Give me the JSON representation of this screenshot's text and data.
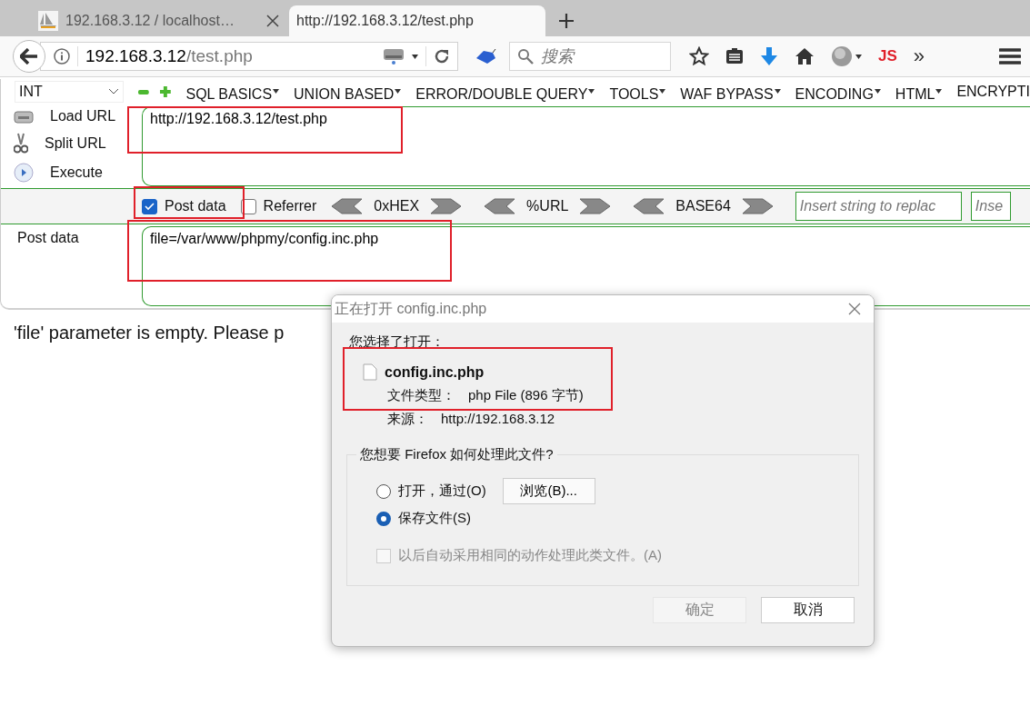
{
  "tabs": [
    {
      "title": "192.168.3.12 / localhost…",
      "selected": false
    },
    {
      "title": "http://192.168.3.12/test.php",
      "selected": true
    }
  ],
  "address_bar": {
    "host": "192.168.3.12",
    "path": "/test.php"
  },
  "search": {
    "placeholder": "搜索"
  },
  "toolbar": {
    "js_button": "JS",
    "overflow": "»"
  },
  "hackbar": {
    "select": "INT",
    "menus": [
      {
        "label": "SQL BASICS",
        "dropdown": true
      },
      {
        "label": "UNION BASED",
        "dropdown": true
      },
      {
        "label": "ERROR/DOUBLE QUERY",
        "dropdown": true
      },
      {
        "label": "TOOLS",
        "dropdown": true
      },
      {
        "label": "WAF BYPASS",
        "dropdown": true
      },
      {
        "label": "ENCODING",
        "dropdown": true
      },
      {
        "label": "HTML",
        "dropdown": true
      },
      {
        "label": "ENCRYPTI",
        "dropdown": false
      }
    ],
    "actions": [
      {
        "label": "Load URL",
        "kind": "load"
      },
      {
        "label": "Split URL",
        "kind": "split"
      },
      {
        "label": "Execute",
        "kind": "execute"
      }
    ],
    "url_value": "http://192.168.3.12/test.php",
    "options": [
      {
        "label": "Post data",
        "checked": true
      },
      {
        "label": "Referrer",
        "checked": false
      }
    ],
    "encoders": [
      "0xHEX",
      "%URL",
      "BASE64"
    ],
    "replace_fields": [
      {
        "placeholder": "Insert string to replac"
      },
      {
        "placeholder": "Inse"
      }
    ],
    "post_label": "Post data",
    "post_value": "file=/var/www/phpmy/config.inc.php"
  },
  "page_text": "'file' parameter is empty. Please p",
  "dialog": {
    "title": "正在打开 config.inc.php",
    "intro": "您选择了打开：",
    "file_name": "config.inc.php",
    "type_label": "文件类型：",
    "type_value": "php File (896 字节)",
    "source_label": "来源：",
    "source_value": "http://192.168.3.12",
    "group_title": "您想要 Firefox 如何处理此文件?",
    "choices": [
      {
        "label": "打开，通过(O)",
        "selected": false,
        "kind": "open"
      },
      {
        "label": "保存文件(S)",
        "selected": true,
        "kind": "save"
      }
    ],
    "browse_button": "浏览(B)...",
    "remember": {
      "label": "以后自动采用相同的动作处理此类文件。(A)",
      "checked": false,
      "disabled": true
    },
    "buttons": [
      {
        "label": "确定",
        "disabled": true
      },
      {
        "label": "取消",
        "disabled": false
      }
    ]
  }
}
